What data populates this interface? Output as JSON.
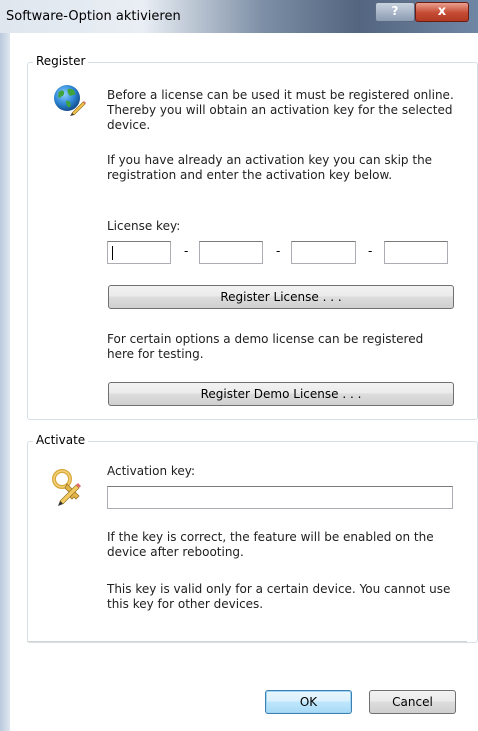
{
  "window": {
    "title": "Software-Option aktivieren",
    "help_glyph": "?",
    "close_glyph": "x"
  },
  "register": {
    "legend": "Register",
    "icon": "globe-pencil-icon",
    "intro_lines": [
      "Before a license can be used it must be registered online.",
      "Thereby you will obtain an activation key for the selected",
      "device."
    ],
    "skip_lines": [
      "If you have already an activation key you can skip the",
      "registration and enter the activation key below."
    ],
    "license_key_label": "License key:",
    "license_key_segments": [
      "",
      "",
      "",
      ""
    ],
    "separator": "-",
    "register_button": "Register License . . .",
    "demo_lines": [
      "For certain options a demo license can be registered",
      "here for testing."
    ],
    "demo_button": "Register Demo License . . ."
  },
  "activate": {
    "legend": "Activate",
    "icon": "key-pencil-icon",
    "activation_key_label": "Activation key:",
    "activation_key_value": "",
    "correct_lines": [
      "If the key is correct, the feature will be enabled on the",
      "device after rebooting."
    ],
    "valid_lines": [
      "This key is valid only for a certain device. You cannot use",
      "this key for other devices."
    ]
  },
  "footer": {
    "ok": "OK",
    "cancel": "Cancel"
  }
}
